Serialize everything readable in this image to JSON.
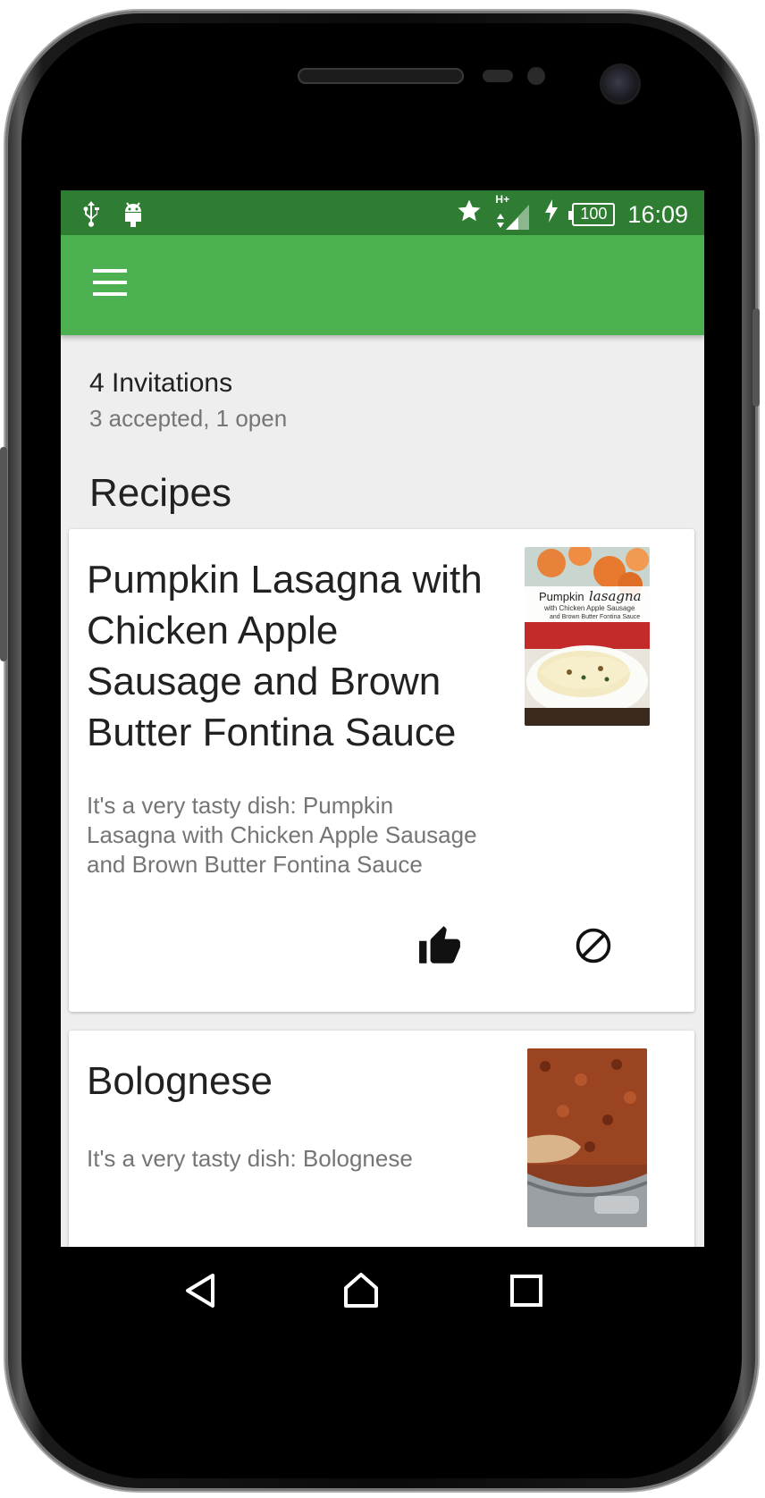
{
  "status_bar": {
    "left_icons": [
      "usb-icon",
      "android-debug-icon"
    ],
    "right_icons": [
      "star-icon",
      "signal-hplus-icon",
      "charging-icon"
    ],
    "signal_label": "H+",
    "battery_level": "100",
    "time": "16:09"
  },
  "app_bar": {
    "menu_icon": "hamburger-menu-icon",
    "color": "#4caf50",
    "status_color": "#2e7d32"
  },
  "invitations": {
    "title": "4 Invitations",
    "subtitle": "3 accepted, 1 open"
  },
  "recipes": {
    "heading": "Recipes",
    "items": [
      {
        "title": "Pumpkin Lasagna with Chicken Apple Sausage and Brown Butter Fontina Sauce",
        "description": "It's a very tasty dish: Pumpkin Lasagna with Chicken Apple Sausage and Brown Butter Fontina Sauce",
        "thumb_caption_1": "Pumpkin",
        "thumb_caption_2": "lasagna",
        "thumb_caption_3": "with Chicken Apple Sausage",
        "thumb_caption_4": "and Brown Butter Fontina Sauce",
        "actions": [
          "thumbs-up-icon",
          "block-icon"
        ]
      },
      {
        "title": "Bolognese",
        "description": "It's a very tasty dish: Bolognese"
      }
    ]
  },
  "nav_bar": {
    "buttons": [
      "back-icon",
      "home-icon",
      "recents-icon"
    ]
  }
}
